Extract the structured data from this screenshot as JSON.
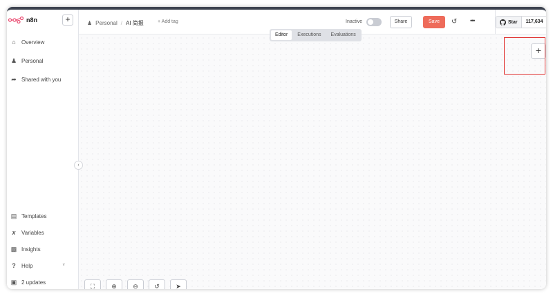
{
  "sidebar": {
    "logo": "n8n",
    "items": [
      {
        "label": "Overview",
        "icon": "home-icon"
      },
      {
        "label": "Personal",
        "icon": "user-icon"
      },
      {
        "label": "Shared with you",
        "icon": "share-icon"
      }
    ],
    "bottom_items": [
      {
        "label": "Templates",
        "icon": "templates-icon"
      },
      {
        "label": "Variables",
        "icon": "variables-icon"
      },
      {
        "label": "Insights",
        "icon": "chart-icon"
      },
      {
        "label": "Help",
        "icon": "help-icon"
      },
      {
        "label": "2 updates",
        "icon": "gift-icon"
      }
    ]
  },
  "header": {
    "breadcrumb_project": "Personal",
    "breadcrumb_separator": "/",
    "workflow_name": "AI 简报",
    "add_tag": "+ Add tag",
    "status_label": "Inactive",
    "share_label": "Share",
    "save_label": "Save",
    "github_star": "Star",
    "github_count": "117,634"
  },
  "tabs": [
    {
      "label": "Editor",
      "active": true
    },
    {
      "label": "Executions",
      "active": false
    },
    {
      "label": "Evaluations",
      "active": false
    }
  ],
  "colors": {
    "save": "#ee6b5a",
    "highlight": "#e0302e",
    "logo": "#ea4b71"
  }
}
